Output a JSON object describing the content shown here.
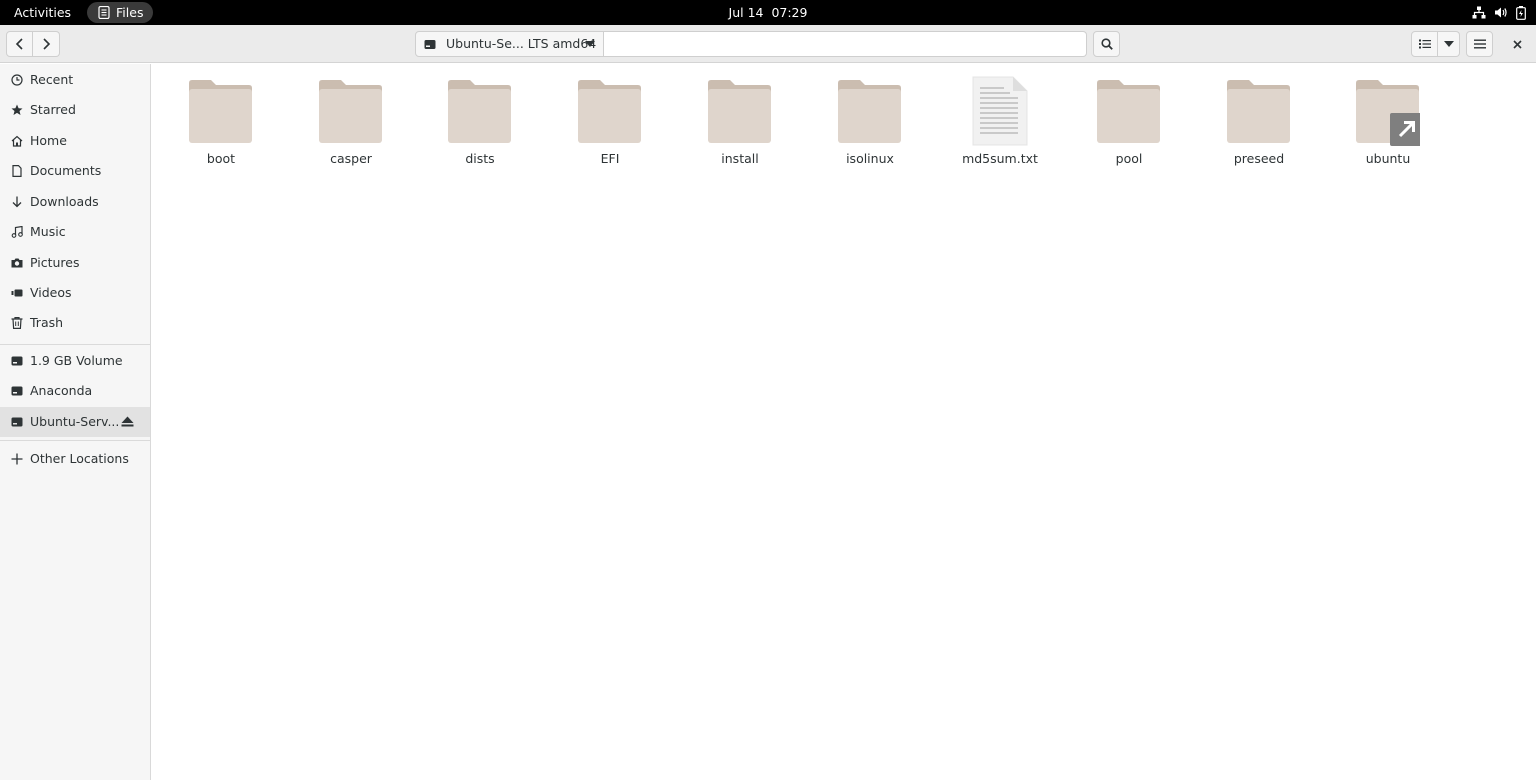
{
  "topbar": {
    "activities": "Activities",
    "app_name": "Files",
    "date": "Jul 14",
    "time": "07:29",
    "tray_icons": [
      "network-wired-icon",
      "volume-icon",
      "battery-icon"
    ]
  },
  "headerbar": {
    "location_label": "Ubuntu-Se... LTS amd64",
    "location_entry_value": "",
    "icons": [
      "back-icon",
      "forward-icon",
      "drive-icon",
      "dropdown-icon",
      "search-icon",
      "list-view-icon",
      "view-options-icon",
      "hamburger-menu-icon",
      "close-icon"
    ]
  },
  "sidebar": {
    "places": [
      {
        "label": "Recent",
        "icon": "clock-icon"
      },
      {
        "label": "Starred",
        "icon": "star-icon"
      },
      {
        "label": "Home",
        "icon": "home-icon"
      },
      {
        "label": "Documents",
        "icon": "document-icon"
      },
      {
        "label": "Downloads",
        "icon": "download-icon"
      },
      {
        "label": "Music",
        "icon": "music-icon"
      },
      {
        "label": "Pictures",
        "icon": "camera-icon"
      },
      {
        "label": "Videos",
        "icon": "video-icon"
      },
      {
        "label": "Trash",
        "icon": "trash-icon"
      }
    ],
    "devices": [
      {
        "label": "1.9 GB Volume",
        "icon": "drive-icon"
      },
      {
        "label": "Anaconda",
        "icon": "drive-icon"
      },
      {
        "label": "Ubuntu-Serv...",
        "icon": "drive-icon",
        "eject": "eject-icon",
        "active": true
      }
    ],
    "other": {
      "label": "Other Locations",
      "icon": "plus-icon"
    }
  },
  "files": [
    {
      "name": "boot",
      "type": "folder"
    },
    {
      "name": "casper",
      "type": "folder"
    },
    {
      "name": "dists",
      "type": "folder"
    },
    {
      "name": "EFI",
      "type": "folder"
    },
    {
      "name": "install",
      "type": "folder"
    },
    {
      "name": "isolinux",
      "type": "folder"
    },
    {
      "name": "md5sum.txt",
      "type": "text-file"
    },
    {
      "name": "pool",
      "type": "folder"
    },
    {
      "name": "preseed",
      "type": "folder"
    },
    {
      "name": "ubuntu",
      "type": "folder-symlink"
    }
  ],
  "colors": {
    "topbar_bg": "#000000",
    "headerbar_bg": "#ebebeb",
    "sidebar_bg": "#f6f6f6",
    "folder_body": "#dfd5cc",
    "folder_tab": "#cbbdb0",
    "symlink_badge": "#7f7f7f"
  }
}
